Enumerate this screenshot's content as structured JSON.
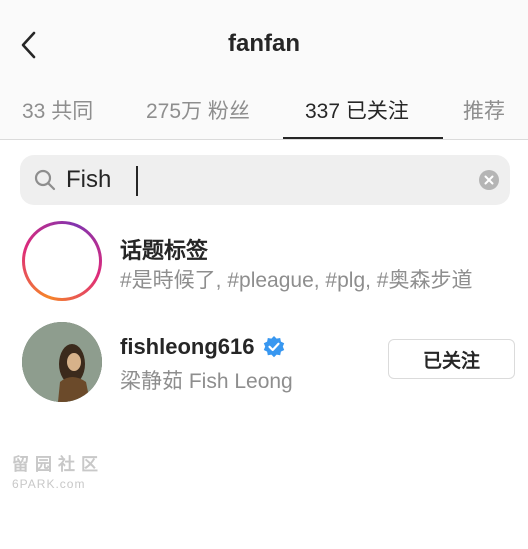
{
  "header": {
    "title": "fanfan",
    "back_icon": "chevron-left-icon"
  },
  "tabs": [
    {
      "label": "33 共同",
      "active": false
    },
    {
      "label": "275万 粉丝",
      "active": false
    },
    {
      "label": "337 已关注",
      "active": true
    },
    {
      "label": "推荐",
      "active": false
    }
  ],
  "search": {
    "value": "Fish",
    "icon": "search-icon",
    "clear_icon": "clear-icon"
  },
  "results": [
    {
      "type": "hashtag",
      "title": "话题标签",
      "subtitle": "#是時候了, #pleague, #plg, #奥森步道",
      "icon": "hashtag-icon"
    },
    {
      "type": "user",
      "username": "fishleong616",
      "verified": true,
      "full_name": "梁静茹 Fish Leong",
      "follow_label": "已关注"
    }
  ],
  "watermark": {
    "text": "留园社区",
    "site": "6PARK.com"
  },
  "colors": {
    "text_primary": "#262626",
    "text_secondary": "#8e8e8e",
    "verified_blue": "#3897f0",
    "divider": "#dbdbdb"
  }
}
